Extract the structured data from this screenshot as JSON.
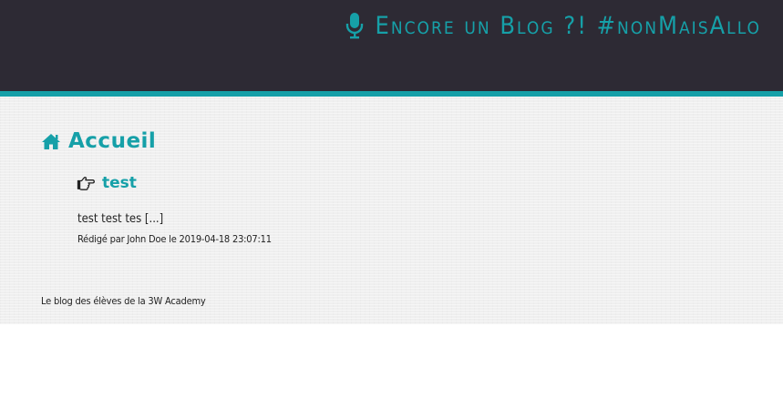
{
  "header": {
    "title": "Encore un Blog ?! #nonMaisAllo",
    "icon": "microphone-icon"
  },
  "page": {
    "heading": "Accueil",
    "heading_icon": "home-icon"
  },
  "posts": [
    {
      "icon": "hand-pointing-right-icon",
      "title": "test",
      "excerpt": "test test tes  [...]",
      "meta": "Rédigé par John Doe le 2019-04-18 23:07:11"
    }
  ],
  "footer": {
    "text": "Le blog des élèves de la 3W Academy"
  },
  "colors": {
    "header_bg": "#2d2a34",
    "accent": "#16a0a8",
    "content_bg": "#efefef"
  }
}
